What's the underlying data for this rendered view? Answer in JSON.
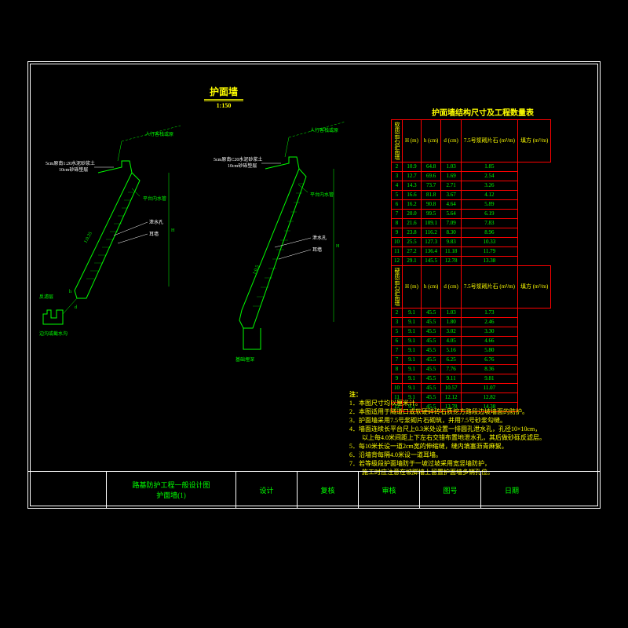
{
  "title": "护面墙",
  "scale": "1:150",
  "table_title": "护面墙结构尺寸及工程数量表",
  "table": {
    "headers": [
      "H (m)",
      "h (cm)",
      "d (cm)",
      "7.5号浆砌片石 (m³/m)",
      "填方 (m³/m)"
    ],
    "section1_label": "软质岩石护面墙",
    "section2_label": "硬质岩石护面墙",
    "rows1": [
      [
        "2",
        "10.9",
        "64.8",
        "1.03",
        "1.85"
      ],
      [
        "3",
        "12.7",
        "69.6",
        "1.69",
        "2.54"
      ],
      [
        "4",
        "14.3",
        "73.7",
        "2.71",
        "3.26"
      ],
      [
        "5",
        "16.6",
        "81.8",
        "3.67",
        "4.12"
      ],
      [
        "6",
        "16.2",
        "90.8",
        "4.64",
        "5.89"
      ],
      [
        "7",
        "20.0",
        "99.5",
        "5.64",
        "6.19"
      ],
      [
        "8",
        "21.6",
        "109.1",
        "7.09",
        "7.83"
      ],
      [
        "9",
        "23.8",
        "116.2",
        "8.30",
        "8.96"
      ],
      [
        "10",
        "25.5",
        "127.3",
        "9.83",
        "10.33"
      ],
      [
        "11",
        "27.2",
        "136.4",
        "11.18",
        "11.79"
      ],
      [
        "12",
        "29.1",
        "145.5",
        "12.78",
        "13.38"
      ]
    ],
    "headers2": [
      "H (m)",
      "h (cm)",
      "d (cm)",
      "7.5号浆砌片石 (m³/m)",
      "填方 (m³/m)"
    ],
    "rows2": [
      [
        "2",
        "9.1",
        "45.5",
        "1.03",
        "1.73"
      ],
      [
        "3",
        "9.1",
        "45.5",
        "1.80",
        "2.46"
      ],
      [
        "5",
        "9.1",
        "45.5",
        "3.02",
        "3.30"
      ],
      [
        "6",
        "9.1",
        "45.5",
        "4.05",
        "4.66"
      ],
      [
        "7",
        "9.1",
        "45.5",
        "5.16",
        "5.80"
      ],
      [
        "7",
        "9.1",
        "45.5",
        "6.25",
        "6.76"
      ],
      [
        "8",
        "9.1",
        "45.5",
        "7.76",
        "8.36"
      ],
      [
        "9",
        "9.1",
        "45.5",
        "9.11",
        "9.81"
      ],
      [
        "10",
        "9.1",
        "45.5",
        "10.57",
        "11.07"
      ],
      [
        "11",
        "9.1",
        "45.5",
        "12.12",
        "12.82"
      ],
      [
        "12",
        "9.1",
        "45.5",
        "13.78",
        "14.38"
      ]
    ]
  },
  "notes_title": "注：",
  "notes": [
    "1．本图尺寸均以厘米计。",
    "2．本图适用于隧道口或软硬碎砖石质挖方路段边坡墙面的防护。",
    "3．护面墙采用7.5号浆砌片石砌筑，并用7.5号砂浆勾缝。",
    "4．墙面连续长平台尺上0.3米处设置一排圆孔泄水孔，孔径10×10cm，",
    "　　以上每4.0米间距上下左右交错布置地泄水孔，其后做砂砾反滤层。",
    "5．每10米长设一道2cm宽的伸缩缝，缝内填塞沥青麻絮。",
    "6．沿墙背每隔4.0米设一道耳墙。",
    "7．若等级段护面墙防于一坡过坡采用宽竖墙防护，",
    "　　施工时应注意在坡脚墙上留置护面墙多销孔位。"
  ],
  "labels": {
    "figure1": "5cm原南1:20水泥砂浆土\n10cm砂砾垫层",
    "figure2": "5cm原南C20水泥砂浆土\n10cm砂砾垫层",
    "slope_top": "人行客栈或原",
    "platform": "平台内水管",
    "weep": "泄水孔",
    "ear_wall": "耳墙",
    "filter": "反滤层",
    "drain": "边沟或截水沟",
    "slope_ratio": "1:0.25",
    "slope_ratio2": "1:0.5"
  },
  "titleblock": {
    "project": "路基防护工程一般设计图",
    "sheet": "护面墙(1)",
    "design": "设计",
    "check": "复核",
    "review": "审核",
    "drawing_no": "图号",
    "date": "日期"
  },
  "chart_data": {
    "type": "table",
    "title": "护面墙结构尺寸及工程数量表",
    "series": [
      {
        "name": "软质岩石护面墙",
        "columns": [
          "H(m)",
          "h(cm)",
          "d(cm)",
          "浆砌片石(m³/m)",
          "填方(m³/m)"
        ],
        "rows": [
          [
            2,
            10.9,
            64.8,
            1.03,
            1.85
          ],
          [
            3,
            12.7,
            69.6,
            1.69,
            2.54
          ],
          [
            4,
            14.3,
            73.7,
            2.71,
            3.26
          ],
          [
            5,
            16.6,
            81.8,
            3.67,
            4.12
          ],
          [
            6,
            16.2,
            90.8,
            4.64,
            5.89
          ],
          [
            7,
            20.0,
            99.5,
            5.64,
            6.19
          ],
          [
            8,
            21.6,
            109.1,
            7.09,
            7.83
          ],
          [
            9,
            23.8,
            116.2,
            8.3,
            8.96
          ],
          [
            10,
            25.5,
            127.3,
            9.83,
            10.33
          ],
          [
            11,
            27.2,
            136.4,
            11.18,
            11.79
          ],
          [
            12,
            29.1,
            145.5,
            12.78,
            13.38
          ]
        ]
      },
      {
        "name": "硬质岩石护面墙",
        "columns": [
          "H(m)",
          "h(cm)",
          "d(cm)",
          "浆砌片石(m³/m)",
          "填方(m³/m)"
        ],
        "rows": [
          [
            2,
            9.1,
            45.5,
            1.03,
            1.73
          ],
          [
            3,
            9.1,
            45.5,
            1.8,
            2.46
          ],
          [
            5,
            9.1,
            45.5,
            3.02,
            3.3
          ],
          [
            6,
            9.1,
            45.5,
            4.05,
            4.66
          ],
          [
            7,
            9.1,
            45.5,
            5.16,
            5.8
          ],
          [
            7,
            9.1,
            45.5,
            6.25,
            6.76
          ],
          [
            8,
            9.1,
            45.5,
            7.76,
            8.36
          ],
          [
            9,
            9.1,
            45.5,
            9.11,
            9.81
          ],
          [
            10,
            9.1,
            45.5,
            10.57,
            11.07
          ],
          [
            11,
            9.1,
            45.5,
            12.12,
            12.82
          ],
          [
            12,
            9.1,
            45.5,
            13.78,
            14.38
          ]
        ]
      }
    ]
  }
}
